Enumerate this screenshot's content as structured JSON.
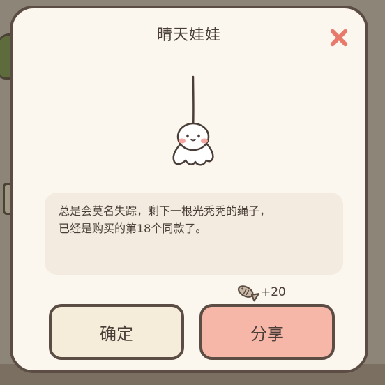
{
  "dialog": {
    "title": "晴天娃娃",
    "description_lines": [
      "总是会莫名失踪，剩下一根光秃秃的绳子，",
      "已经是购买的第18个同款了。"
    ],
    "reward": {
      "icon": "fish-icon",
      "amount": "+20"
    },
    "confirm_label": "确定",
    "share_label": "分享"
  },
  "colors": {
    "dialog_bg": "#fbf6ee",
    "border": "#5b4d44",
    "close_x": "#e87a6c",
    "confirm_bg": "#f5ecda",
    "share_bg": "#f6b6a8",
    "desc_bg": "#f3ebdf"
  }
}
